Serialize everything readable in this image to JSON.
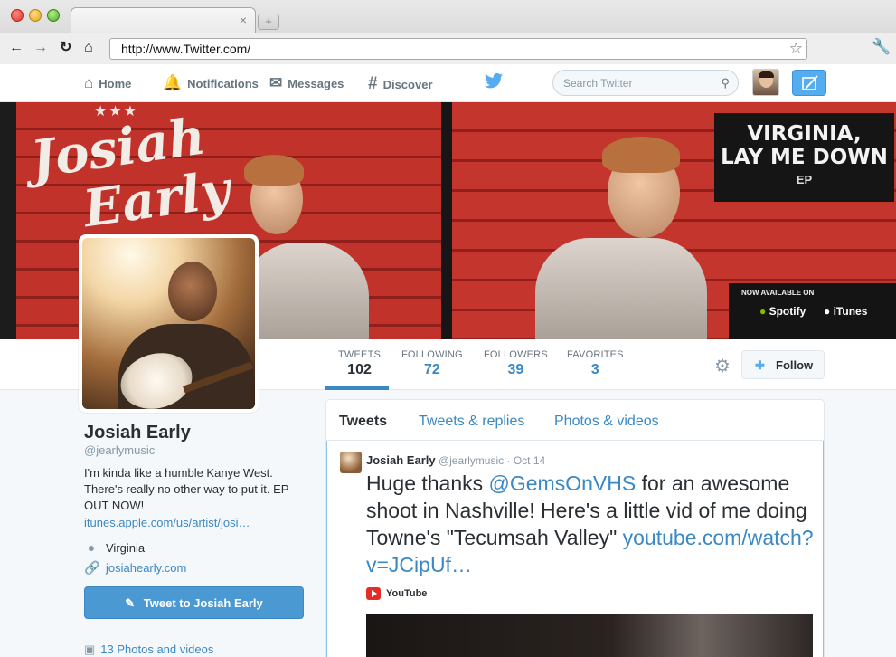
{
  "browser": {
    "url": "http://www.Twitter.com/",
    "tab_close": "×",
    "new_tab": "+",
    "icons": [
      "back-icon",
      "forward-icon",
      "reload-icon",
      "home-icon",
      "star-icon",
      "wrench-icon"
    ]
  },
  "twitter_nav": {
    "home": "Home",
    "notifications": "Notifications",
    "messages": "Messages",
    "discover": "Discover",
    "search_placeholder": "Search Twitter",
    "brand_color": "#55acee"
  },
  "banner": {
    "script_line1": "Josiah",
    "script_line2": "Early",
    "stars": "★★★",
    "ep_title_1": "VIRGINIA,",
    "ep_title_2": "LAY ME DOWN",
    "ep_sub": "EP",
    "available_on": "NOW AVAILABLE ON",
    "spotify": "Spotify",
    "itunes": "iTunes"
  },
  "stats": [
    {
      "label": "TWEETS",
      "value": "102"
    },
    {
      "label": "FOLLOWING",
      "value": "72"
    },
    {
      "label": "FOLLOWERS",
      "value": "39"
    },
    {
      "label": "FAVORITES",
      "value": "3"
    }
  ],
  "follow_label": "Follow",
  "profile": {
    "name": "Josiah Early",
    "handle": "@jearlymusic",
    "bio": "I'm kinda like a humble Kanye West. There's really no other way to put it. EP OUT NOW!",
    "bio_link": "itunes.apple.com/us/artist/josi…",
    "location": "Virginia",
    "website": "josiahearly.com",
    "tweet_to": "Tweet to Josiah Early",
    "photos": "13 Photos and videos"
  },
  "timeline": {
    "tabs": [
      "Tweets",
      "Tweets & replies",
      "Photos & videos"
    ],
    "tweet": {
      "author": "Josiah Early",
      "handle": "@jearlymusic",
      "sep": "·",
      "date": "Oct 14",
      "text_1": "Huge thanks ",
      "mention": "@GemsOnVHS",
      "text_2": " for an awesome shoot in Nashville! Here's a little vid of me doing Towne's \"Tecumsah Valley\" ",
      "link": "youtube.com/watch?v=JCipUf…",
      "card_source": "YouTube"
    }
  }
}
